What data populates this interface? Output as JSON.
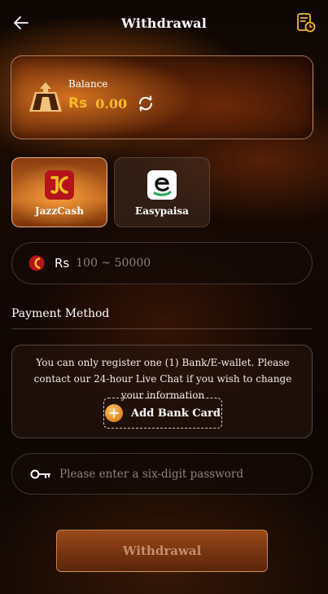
{
  "header": {
    "title": "Withdrawal",
    "back_icon": "arrow-left-icon",
    "history_icon": "history-record-icon"
  },
  "balance": {
    "label": "Balance",
    "currency": "Rs",
    "amount": "0.00",
    "refresh_icon": "refresh-icon"
  },
  "payment_options": [
    {
      "name": "JazzCash",
      "selected": true
    },
    {
      "name": "Easypaisa",
      "selected": false
    }
  ],
  "amount_input": {
    "currency": "Rs",
    "placeholder": "100 ~ 50000",
    "value": ""
  },
  "payment_method": {
    "label": "Payment Method",
    "note": "You can only register one (1) Bank/E-wallet. Please contact our 24-hour Live Chat if you wish to change your information",
    "add_button": "Add Bank Card"
  },
  "password_input": {
    "placeholder": "Please enter a six-digit password",
    "value": ""
  },
  "submit": {
    "label": "Withdrawal"
  },
  "colors": {
    "accent": "#f6b92b",
    "jazzcash_red": "#b5121b",
    "easypaisa_green": "#1fa855"
  }
}
